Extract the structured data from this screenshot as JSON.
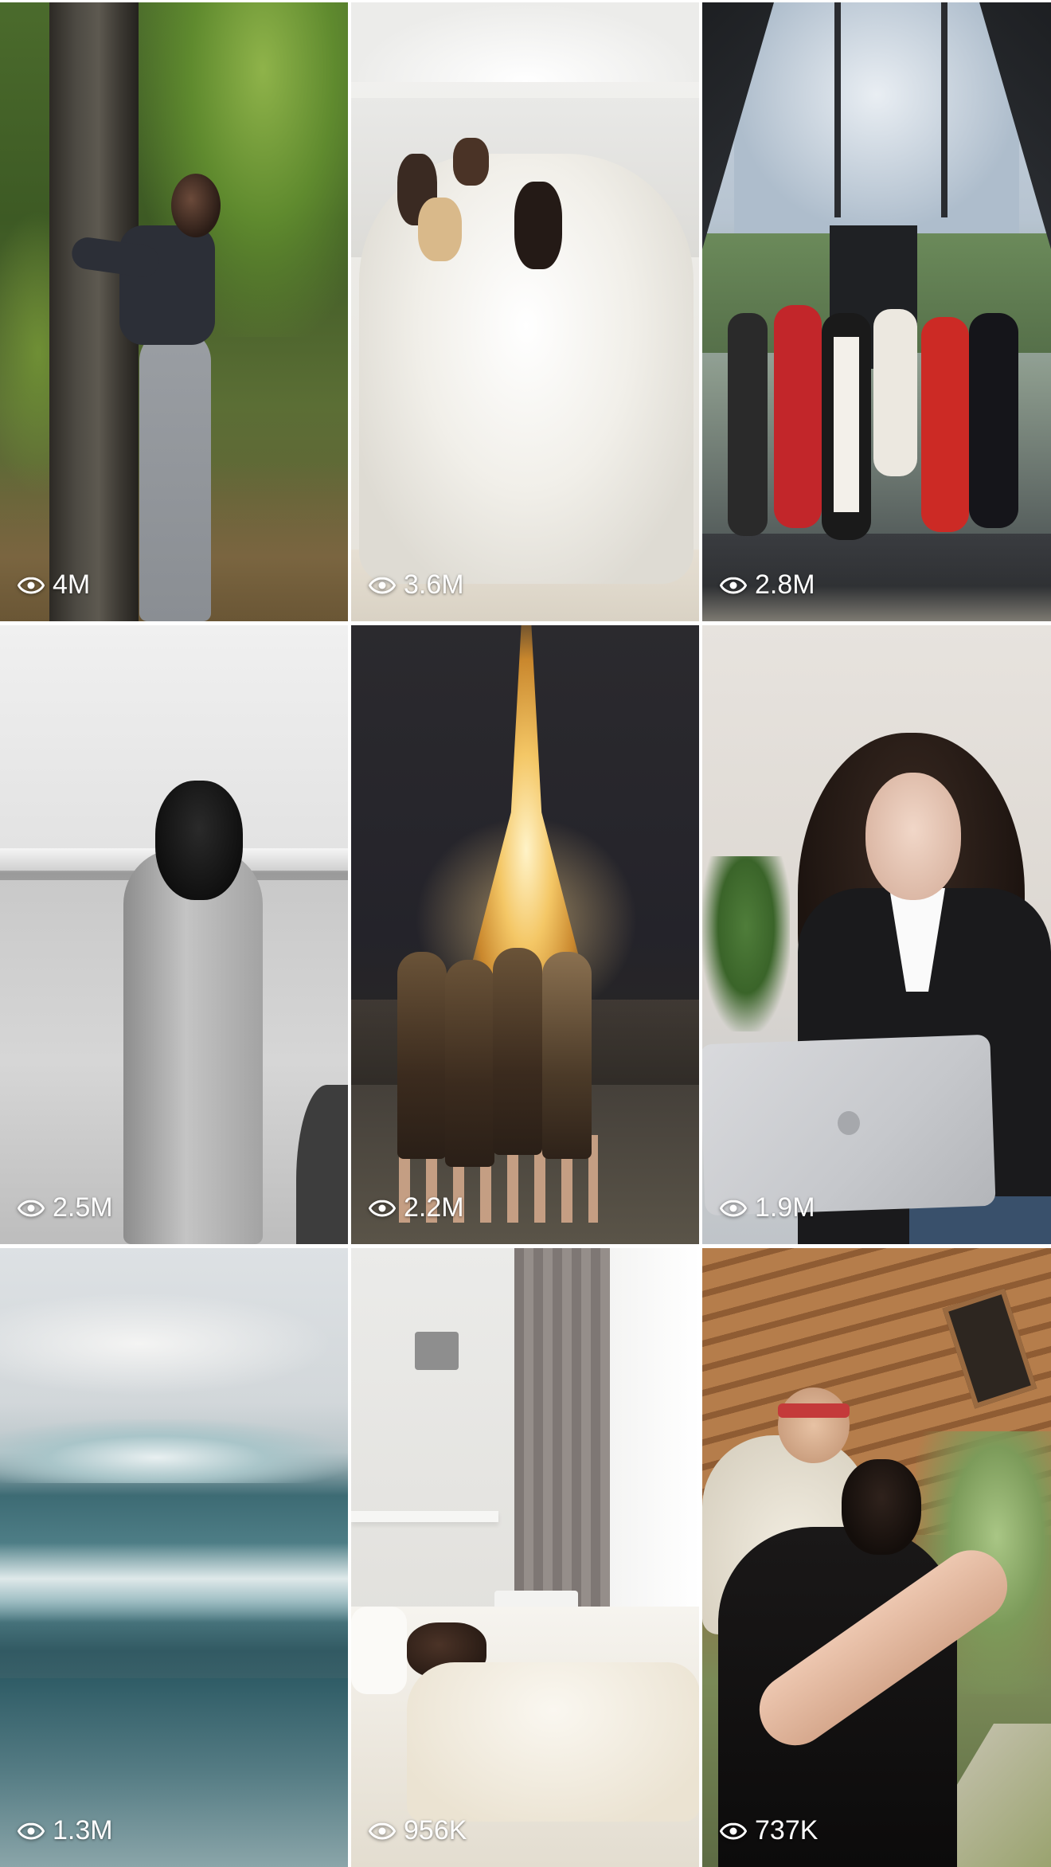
{
  "grid": {
    "tiles": [
      {
        "views": "4M",
        "icon": "eye-icon"
      },
      {
        "views": "3.6M",
        "icon": "eye-icon"
      },
      {
        "views": "2.8M",
        "icon": "eye-icon"
      },
      {
        "views": "2.5M",
        "icon": "eye-icon"
      },
      {
        "views": "2.2M",
        "icon": "eye-icon"
      },
      {
        "views": "1.9M",
        "icon": "eye-icon"
      },
      {
        "views": "1.3M",
        "icon": "eye-icon"
      },
      {
        "views": "956K",
        "icon": "eye-icon"
      },
      {
        "views": "737K",
        "icon": "eye-icon"
      }
    ]
  },
  "colors": {
    "overlay_text": "#ffffff",
    "background": "#ffffff"
  }
}
